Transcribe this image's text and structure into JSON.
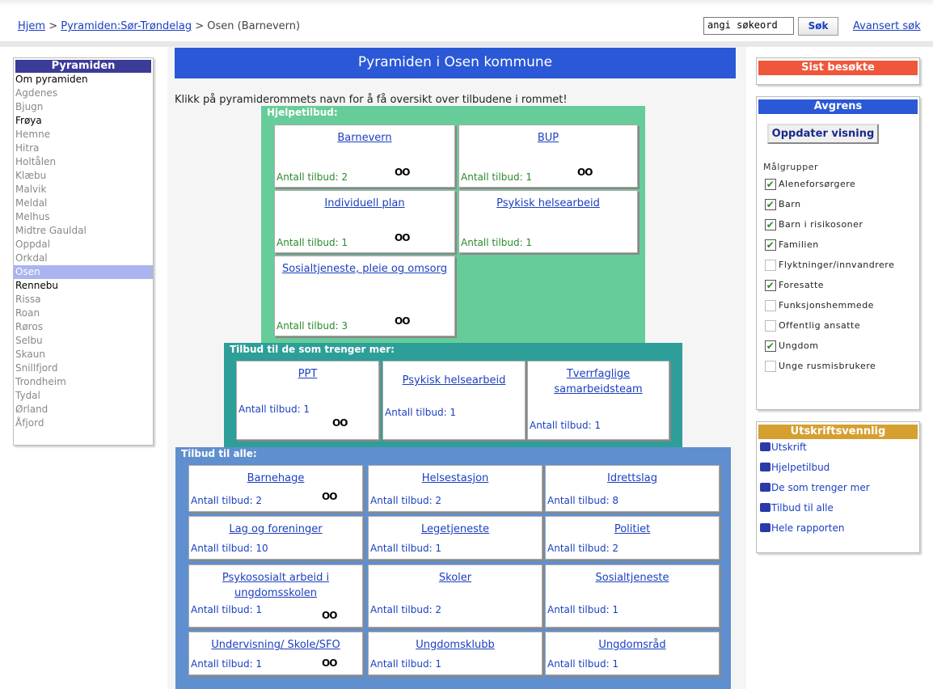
{
  "breadcrumb": {
    "home": "Hjem",
    "sep1": " > ",
    "region": "Pyramiden:Sør-Trøndelag",
    "sep2": " > ",
    "current": "Osen (Barnevern)"
  },
  "search": {
    "value": "angi søkeord",
    "button": "Søk",
    "advanced": "Avansert søk"
  },
  "sidebar": {
    "title": "Pyramiden",
    "items": [
      {
        "label": "Om pyramiden",
        "state": "on"
      },
      {
        "label": "Agdenes",
        "state": "off"
      },
      {
        "label": "Bjugn",
        "state": "off"
      },
      {
        "label": "Frøya",
        "state": "on"
      },
      {
        "label": "Hemne",
        "state": "off"
      },
      {
        "label": "Hitra",
        "state": "off"
      },
      {
        "label": "Holtålen",
        "state": "off"
      },
      {
        "label": "Klæbu",
        "state": "off"
      },
      {
        "label": "Malvik",
        "state": "off"
      },
      {
        "label": "Meldal",
        "state": "off"
      },
      {
        "label": "Melhus",
        "state": "off"
      },
      {
        "label": "Midtre Gauldal",
        "state": "off"
      },
      {
        "label": "Oppdal",
        "state": "off"
      },
      {
        "label": "Orkdal",
        "state": "off"
      },
      {
        "label": "Osen",
        "state": "active"
      },
      {
        "label": "Rennebu",
        "state": "on"
      },
      {
        "label": "Rissa",
        "state": "off"
      },
      {
        "label": "Roan",
        "state": "off"
      },
      {
        "label": "Røros",
        "state": "off"
      },
      {
        "label": "Selbu",
        "state": "off"
      },
      {
        "label": "Skaun",
        "state": "off"
      },
      {
        "label": "Snillfjord",
        "state": "off"
      },
      {
        "label": "Trondheim",
        "state": "off"
      },
      {
        "label": "Tydal",
        "state": "off"
      },
      {
        "label": "Ørland",
        "state": "off"
      },
      {
        "label": "Åfjord",
        "state": "off"
      }
    ]
  },
  "main": {
    "title": "Pyramiden i Osen kommune",
    "intro": "Klikk på pyramiderommets navn for å få oversikt over tilbudene i rommet!"
  },
  "glasses": "ОО",
  "hjelpetilbud": {
    "header": "Hjelpetilbud:",
    "cards": [
      {
        "name": "Barnevern",
        "count": "Antall tilbud: 2",
        "glasses": true
      },
      {
        "name": "BUP",
        "count": "Antall tilbud: 1",
        "glasses": true
      },
      {
        "name": "Individuell plan",
        "count": "Antall tilbud: 1",
        "glasses": true
      },
      {
        "name": "Psykisk helsearbeid",
        "count": "Antall tilbud: 1",
        "glasses": false
      },
      {
        "name": "Sosialtjeneste, pleie og omsorg",
        "count": "Antall tilbud: 3",
        "glasses": true
      }
    ]
  },
  "trenger_mer": {
    "header": "Tilbud til de som trenger mer:",
    "cards": [
      {
        "name": "PPT",
        "count": "Antall tilbud: 1",
        "glasses": true
      },
      {
        "name": "Psykisk helsearbeid",
        "count": "Antall tilbud: 1",
        "glasses": false
      },
      {
        "name": "Tverrfaglige samarbeidsteam",
        "count": "Antall tilbud: 1",
        "glasses": false
      }
    ]
  },
  "alle": {
    "header": "Tilbud til alle:",
    "cards": [
      {
        "name": "Barnehage",
        "count": "Antall tilbud: 2",
        "glasses": true
      },
      {
        "name": "Helsestasjon",
        "count": "Antall tilbud: 2",
        "glasses": false
      },
      {
        "name": "Idrettslag",
        "count": "Antall tilbud: 8",
        "glasses": false
      },
      {
        "name": "Lag og foreninger",
        "count": "Antall tilbud: 10",
        "glasses": false
      },
      {
        "name": "Legetjeneste",
        "count": "Antall tilbud: 1",
        "glasses": false
      },
      {
        "name": "Politiet",
        "count": "Antall tilbud: 2",
        "glasses": false
      },
      {
        "name": "Psykososialt arbeid i ungdomsskolen",
        "count": "Antall tilbud: 1",
        "glasses": true
      },
      {
        "name": "Skoler",
        "count": "Antall tilbud: 2",
        "glasses": false
      },
      {
        "name": "Sosialtjeneste",
        "count": "Antall tilbud: 1",
        "glasses": false
      },
      {
        "name": "Undervisning/ Skole/SFO",
        "count": "Antall tilbud: 1",
        "glasses": true
      },
      {
        "name": "Ungdomsklubb",
        "count": "Antall tilbud: 1",
        "glasses": false
      },
      {
        "name": "Ungdomsråd",
        "count": "Antall tilbud: 1",
        "glasses": false
      }
    ]
  },
  "right": {
    "sist": {
      "title": "Sist besøkte",
      "color": "#f0573a"
    },
    "avgrens": {
      "title": "Avgrens",
      "color": "#2a58d6",
      "update": "Oppdater visning",
      "group_label": "Målgrupper",
      "items": [
        {
          "label": "Aleneforsørgere",
          "checked": true
        },
        {
          "label": "Barn",
          "checked": true
        },
        {
          "label": "Barn i risikosoner",
          "checked": true
        },
        {
          "label": "Familien",
          "checked": true
        },
        {
          "label": "Flyktninger/innvandrere",
          "checked": false
        },
        {
          "label": "Foresatte",
          "checked": true
        },
        {
          "label": "Funksjonshemmede",
          "checked": false
        },
        {
          "label": "Offentlig ansatte",
          "checked": false
        },
        {
          "label": "Ungdom",
          "checked": true
        },
        {
          "label": "Unge rusmisbrukere",
          "checked": false
        }
      ]
    },
    "utskrift": {
      "title": "Utskriftsvennlig",
      "color": "#d6a030",
      "items": [
        "Utskrift",
        "Hjelpetilbud",
        "De som trenger mer",
        "Tilbud til alle",
        "Hele rapporten"
      ]
    }
  },
  "checkmark": "✔"
}
